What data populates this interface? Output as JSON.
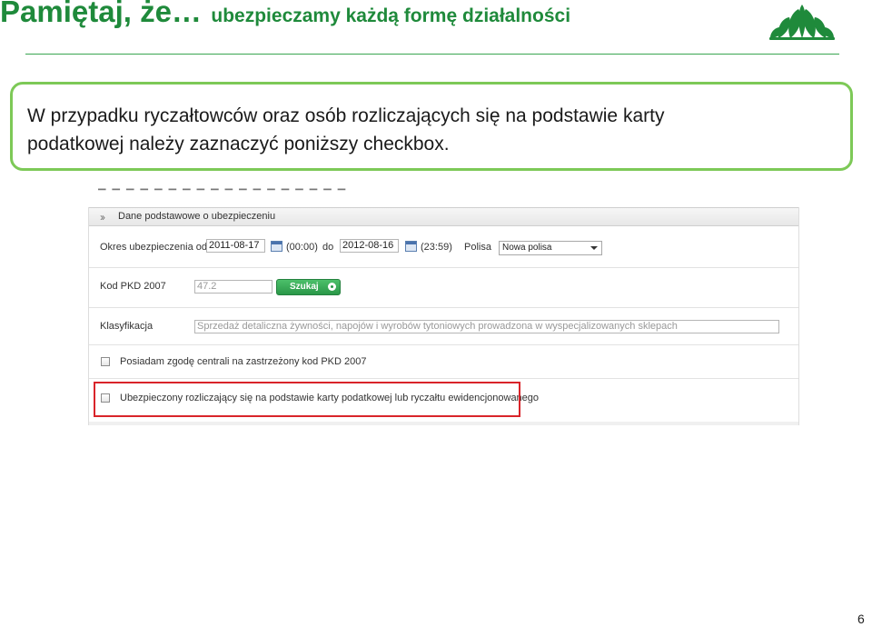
{
  "slide": {
    "title_main": "Pamiętaj, że…",
    "title_sub": "ubezpieczamy każdą formę działalności",
    "callout_line1": "W przypadku ryczałtowców oraz osób rozliczających się na podstawie karty",
    "callout_line2": "podatkowej należy zaznaczyć poniższy checkbox.",
    "page_number": "6",
    "brand_color": "#1f8a3b"
  },
  "panel": {
    "header": "Dane podstawowe o ubezpieczeniu",
    "period_label": "Okres ubezpieczenia od",
    "date_from": "2011-08-17",
    "time_from": "(00:00)",
    "to_label": "do",
    "date_to": "2012-08-16",
    "time_to": "(23:59)",
    "policy_label": "Polisa",
    "policy_value": "Nowa polisa",
    "pkd_label": "Kod PKD 2007",
    "pkd_value": "47.2",
    "search_button": "Szukaj",
    "classification_label": "Klasyfikacja",
    "classification_value": "Sprzedaż detaliczna żywności, napojów i wyrobów tytoniowych prowadzona w wyspecjalizowanych sklepach",
    "checkbox1_label": "Posiadam zgodę centrali na zastrzeżony kod PKD 2007",
    "checkbox2_label": "Ubezpieczony rozliczający się na podstawie karty podatkowej lub ryczałtu ewidencjonowanego",
    "highlight_color": "#d9242a"
  }
}
